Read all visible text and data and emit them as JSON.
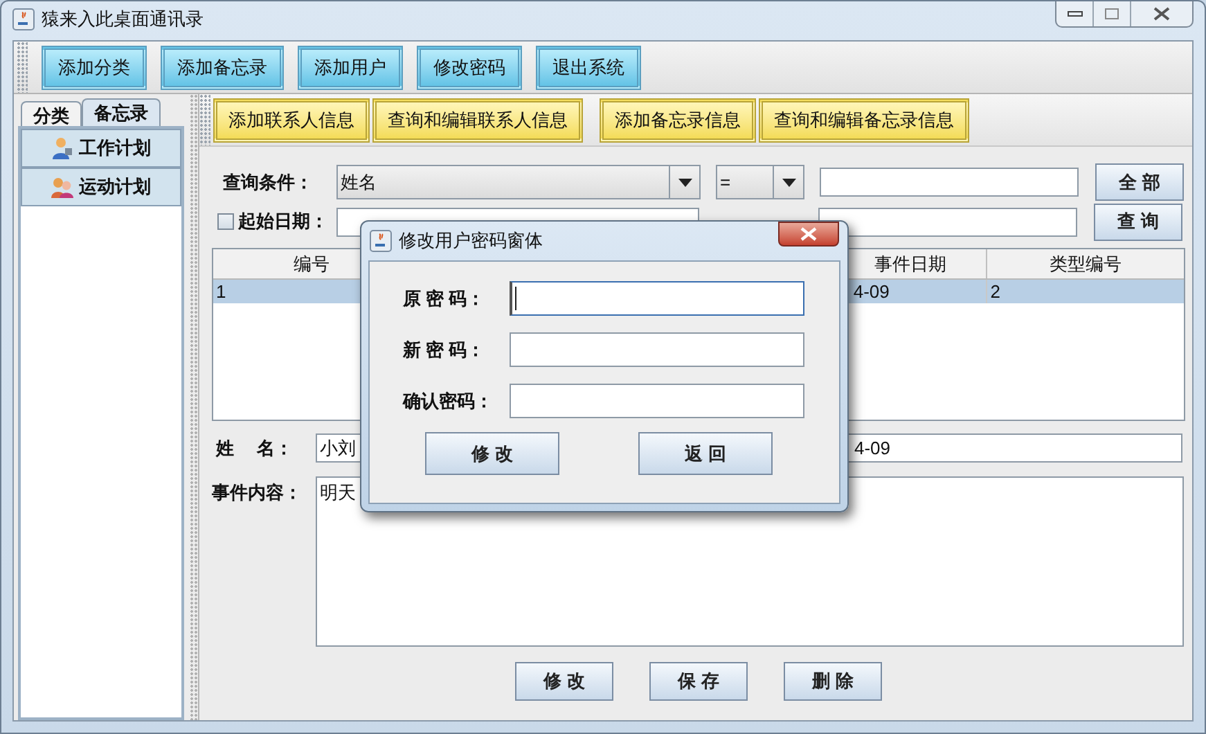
{
  "window": {
    "title": "猿来入此桌面通讯录"
  },
  "toolbar": [
    "添加分类",
    "添加备忘录",
    "添加用户",
    "修改密码",
    "退出系统"
  ],
  "left_tabs": [
    {
      "label": "分类",
      "selected": false
    },
    {
      "label": "备忘录",
      "selected": true
    }
  ],
  "category_list": [
    {
      "label": "工作计划",
      "kind": "person"
    },
    {
      "label": "运动计划",
      "kind": "group"
    }
  ],
  "sub_toolbar": [
    "添加联系人信息",
    "查询和编辑联系人信息",
    "添加备忘录信息",
    "查询和编辑备忘录信息"
  ],
  "query": {
    "condition_label": "查询条件：",
    "field_combo": "姓名",
    "operator_combo": "=",
    "all_button": "全 部",
    "start_date": {
      "label": "起始日期：",
      "checked": false
    },
    "query_button": "查 询"
  },
  "table": {
    "columns": [
      "编号",
      "事件日期",
      "类型编号"
    ],
    "rows": [
      {
        "cells": [
          "1",
          "4-09",
          "2"
        ],
        "selected": true
      }
    ]
  },
  "detail": {
    "name_label": "姓　 名：",
    "name_value": "小刘",
    "date_value": "4-09",
    "content_label": "事件内容：",
    "content_value": "明天"
  },
  "actions": [
    "修 改",
    "保 存",
    "删 除"
  ],
  "dialog": {
    "title": "修改用户密码窗体",
    "fields": [
      {
        "label": "原 密 码：",
        "focused": true
      },
      {
        "label": "新 密 码：",
        "focused": false
      },
      {
        "label": "确认密码：",
        "focused": false
      }
    ],
    "buttons": [
      "修 改",
      "返 回"
    ]
  }
}
